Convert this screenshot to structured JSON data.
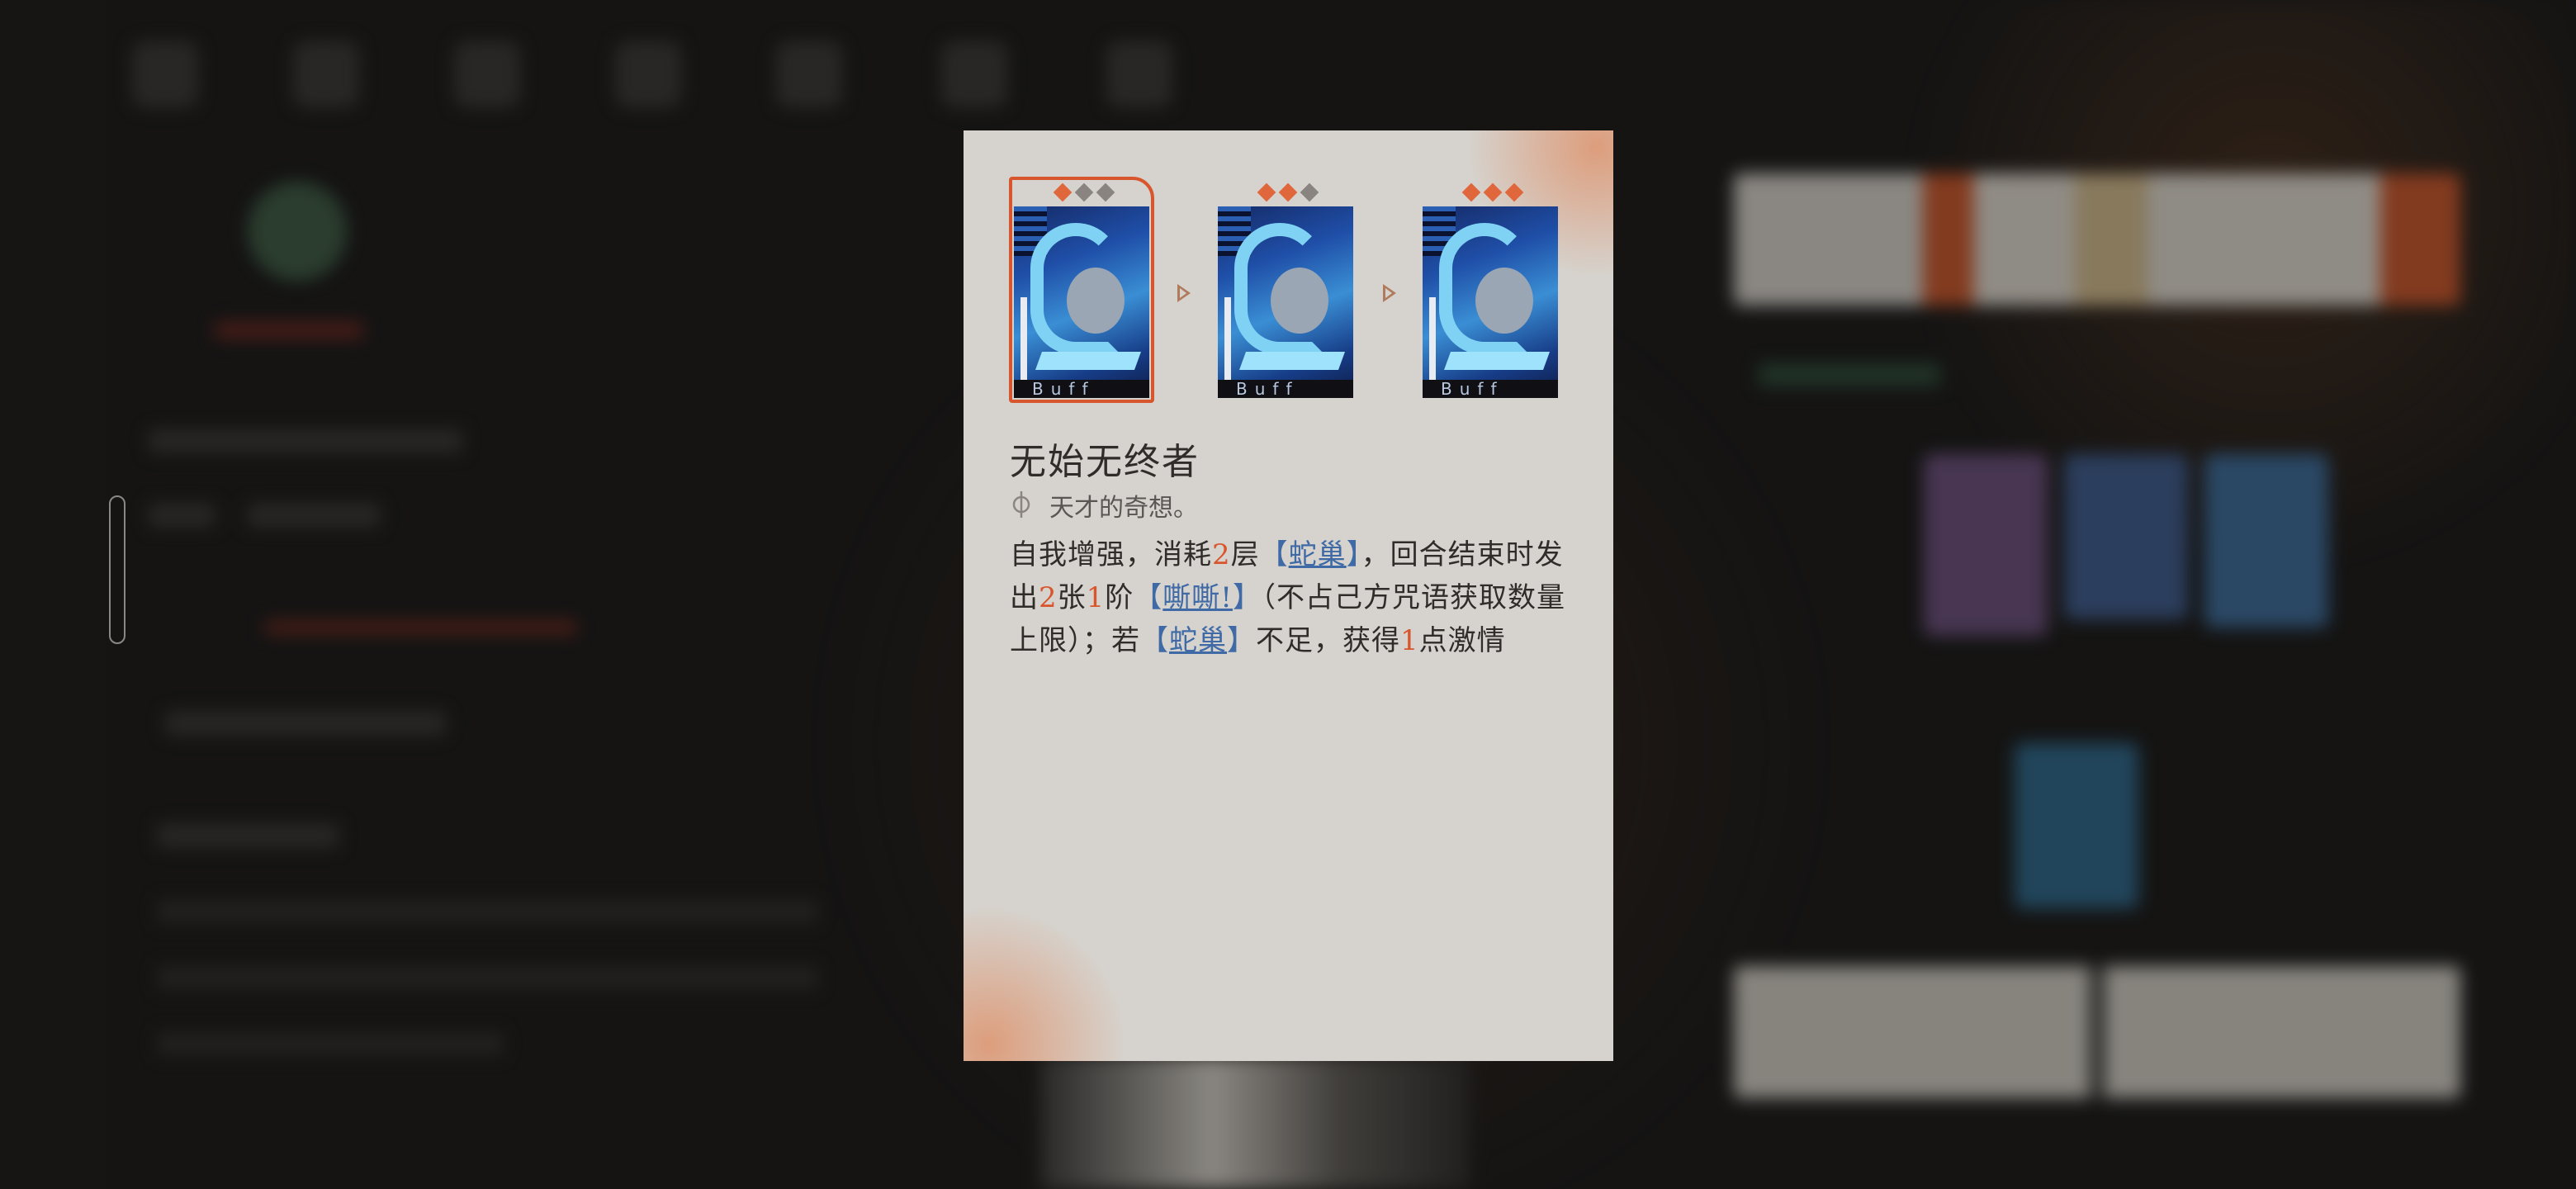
{
  "popup": {
    "title": "无始无终者",
    "subtitle": "天才的奇想。",
    "description": {
      "p1": "自我增强，消耗",
      "n1": "2",
      "p2": "层",
      "kw1": "蛇巢",
      "p3": "，回合结束时发出",
      "n2": "2",
      "p4": "张",
      "n3": "1",
      "p5": "阶",
      "kw2": "嘶嘶!",
      "p6": "（不占己方咒语获取数量上限）；若",
      "kw3": "蛇巢",
      "p7": "不足，获得",
      "n4": "1",
      "p8": "点激情"
    },
    "cards": [
      {
        "label": "Buff",
        "level": "1",
        "pips_on": 1,
        "selected": true
      },
      {
        "label": "Buff",
        "level": "2",
        "pips_on": 2,
        "selected": false
      },
      {
        "label": "Buff",
        "level": "3",
        "pips_on": 3,
        "selected": false
      }
    ]
  },
  "colors": {
    "accent": "#d8562e",
    "keyword": "#3f6aa6",
    "panel_bg": "#d6d3ce",
    "text": "#2f2c2a"
  }
}
